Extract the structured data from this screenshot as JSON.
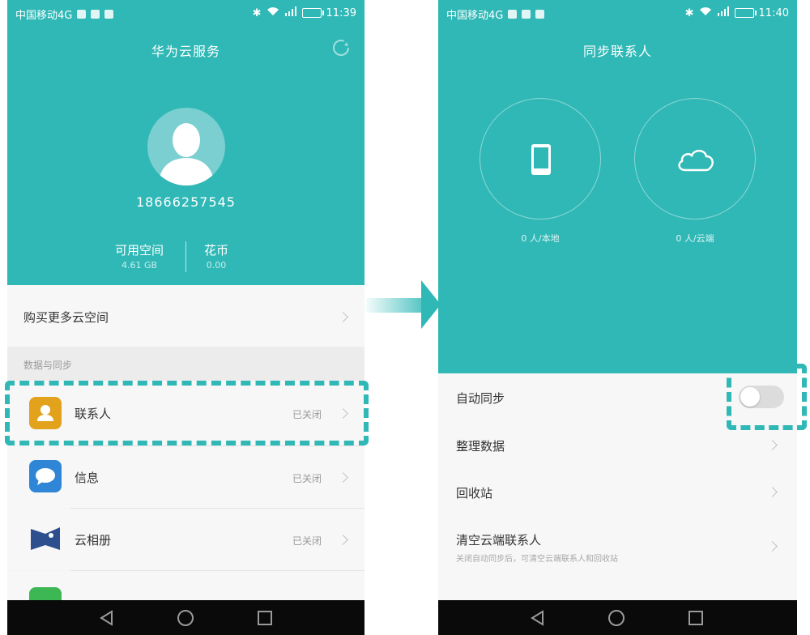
{
  "left_screen": {
    "status": {
      "carrier": "中国移动4G",
      "time": "11:39"
    },
    "title": "华为云服务",
    "account": {
      "phone": "18666257545"
    },
    "stats": [
      {
        "label": "可用空间",
        "value": "4.61 GB"
      },
      {
        "label": "花币",
        "value": "0.00"
      }
    ],
    "buy_more": "购买更多云空间",
    "section_header": "数据与同步",
    "items": [
      {
        "label": "联系人",
        "status": "已关闭",
        "icon": "contacts-icon",
        "color": "#e2a21b"
      },
      {
        "label": "信息",
        "status": "已关闭",
        "icon": "message-icon",
        "color": "#2f86d6"
      },
      {
        "label": "云相册",
        "status": "已关闭",
        "icon": "gallery-icon",
        "color": "#2d4f8e"
      },
      {
        "label": "",
        "icon": "phone-icon",
        "color": "#3cb754"
      }
    ]
  },
  "right_screen": {
    "status": {
      "carrier": "中国移动4G",
      "time": "11:40"
    },
    "title": "同步联系人",
    "local": {
      "caption": "0 人/本地",
      "icon": "phone-device-icon"
    },
    "cloud": {
      "caption": "0 人/云端",
      "icon": "cloud-icon"
    },
    "settings": [
      {
        "label": "自动同步",
        "toggle_on": false
      },
      {
        "label": "整理数据"
      },
      {
        "label": "回收站"
      },
      {
        "label": "清空云端联系人",
        "subtext": "关闭自动同步后，可清空云端联系人和回收站"
      }
    ]
  },
  "colors": {
    "accent": "#2fb8b6",
    "navbar": "#0a0a0a"
  }
}
